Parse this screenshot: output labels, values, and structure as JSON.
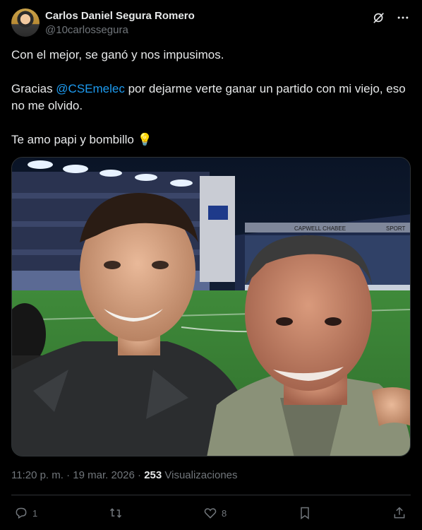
{
  "author": {
    "name": "Carlos Daniel Segura Romero",
    "handle": "@10carlossegura"
  },
  "header_icons": [
    "grok-icon",
    "more-icon"
  ],
  "post": {
    "line1": "Con el mejor, se ganó y nos impusimos.",
    "line2_prefix": "Gracias ",
    "mention": "@CSEmelec",
    "line2_suffix": " por dejarme verte ganar un partido con mi viejo, eso no me olvido.",
    "line3": "Te amo papi y bombillo",
    "emoji": "💡"
  },
  "photo_text": {
    "stand_banner": "CAPWELL CHABEE",
    "board_right": "SPORT"
  },
  "meta": {
    "time": "11:20 p. m.",
    "separator": "·",
    "date": "19 mar. 2026",
    "views_count": "253",
    "views_label": "Visualizaciones"
  },
  "actions": {
    "replies": "1",
    "reposts": "",
    "likes": "8"
  }
}
